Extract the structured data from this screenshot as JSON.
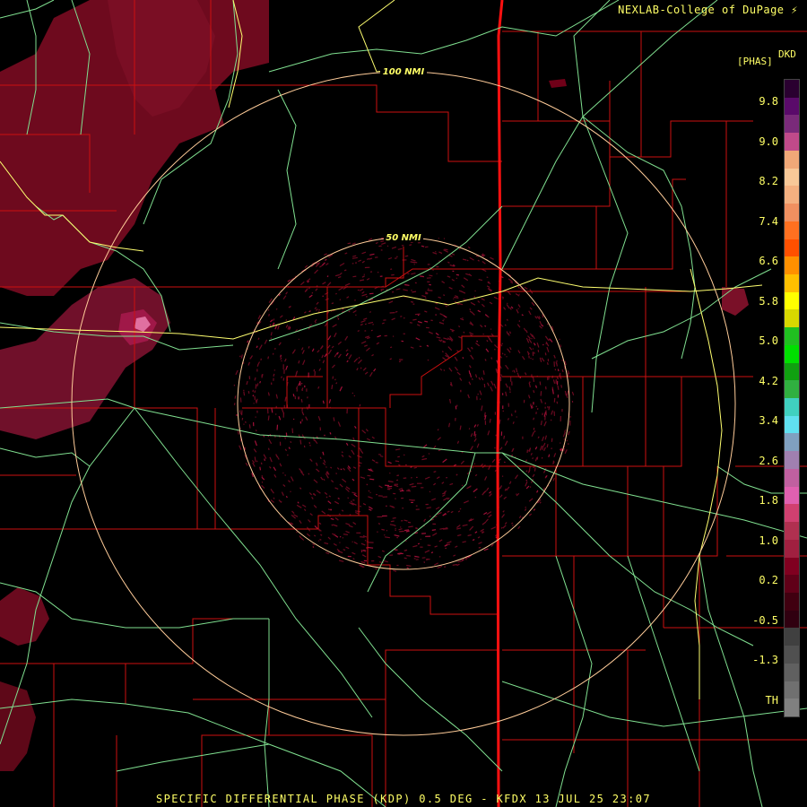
{
  "credit": "NEXLAB-College of DuPage",
  "bottom_caption": "SPECIFIC DIFFERENTIAL PHASE (KDP) 0.5 DEG - KFDX 13 JUL 25 23:07",
  "legend": {
    "product_code": "DKD",
    "unit": "[PHAS]",
    "labels": [
      "9.8",
      "9.0",
      "8.2",
      "7.4",
      "6.6",
      "5.8",
      "5.0",
      "4.2",
      "3.4",
      "2.6",
      "1.8",
      "1.0",
      "0.2",
      "-0.5",
      "-1.3",
      "TH"
    ],
    "colors": [
      "#2a0030",
      "#5a0a6a",
      "#7a2a7a",
      "#c04a8a",
      "#f0a878",
      "#f8c898",
      "#f4b080",
      "#f09060",
      "#ff7020",
      "#ff5000",
      "#ff9000",
      "#ffc000",
      "#ffff00",
      "#d8d800",
      "#20c020",
      "#00e000",
      "#10a010",
      "#30b040",
      "#40d0c0",
      "#60e0f0",
      "#80a0c0",
      "#a080b0",
      "#c060a0",
      "#e060b0",
      "#d04070",
      "#b03050",
      "#a02040",
      "#800020",
      "#600018",
      "#400010",
      "#300010",
      "#404040",
      "#505050",
      "#606060",
      "#707070",
      "#808080"
    ]
  },
  "range_rings": [
    {
      "label": "50 NMI"
    },
    {
      "label": "100 NMI"
    }
  ],
  "colors": {
    "county_lines": "#cc1010",
    "state_line": "#ff1010",
    "highways": "#80e090",
    "interstate": "#ffff70",
    "rings": "#ffcc99",
    "echo": "#700018",
    "echo_bright": "#b01040"
  }
}
